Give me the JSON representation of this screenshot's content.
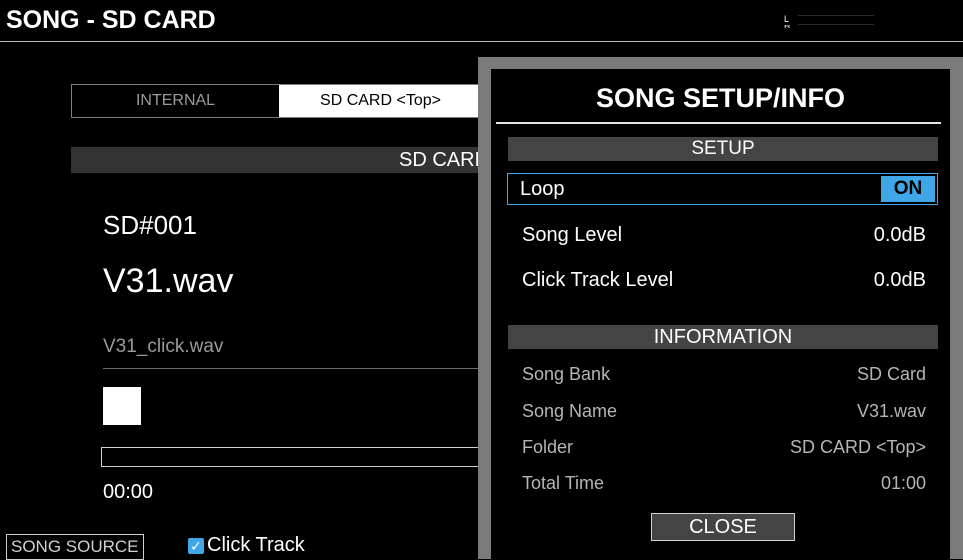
{
  "header": {
    "title": "SONG - SD CARD",
    "meter_l": "L",
    "meter_r": "R"
  },
  "left": {
    "tabs": [
      {
        "label": "INTERNAL"
      },
      {
        "label": "SD CARD <Top>"
      }
    ],
    "band_label": "SD CARD <Top>",
    "song_number": "SD#001",
    "song_name": "V31.wav",
    "click_file": "V31_click.wav",
    "progress_fraction": 0,
    "time": "00:00",
    "song_source_label": "SONG SOURCE",
    "click_track_label": "Click Track",
    "click_track_checked": true
  },
  "dialog": {
    "title": "SONG SETUP/INFO",
    "setup_header": "SETUP",
    "loop_label": "Loop",
    "loop_value": "ON",
    "song_level_label": "Song Level",
    "song_level_value": "0.0dB",
    "click_level_label": "Click Track Level",
    "click_level_value": "0.0dB",
    "info_header": "INFORMATION",
    "info": [
      {
        "label": "Song Bank",
        "value": "SD Card"
      },
      {
        "label": "Song Name",
        "value": "V31.wav"
      },
      {
        "label": "Folder",
        "value": "SD CARD <Top>"
      },
      {
        "label": "Total Time",
        "value": "01:00"
      }
    ],
    "close_label": "CLOSE"
  },
  "colors": {
    "accent": "#3fa6e8",
    "dialog_frame": "#7a7a7a",
    "section_bg": "#444444"
  }
}
